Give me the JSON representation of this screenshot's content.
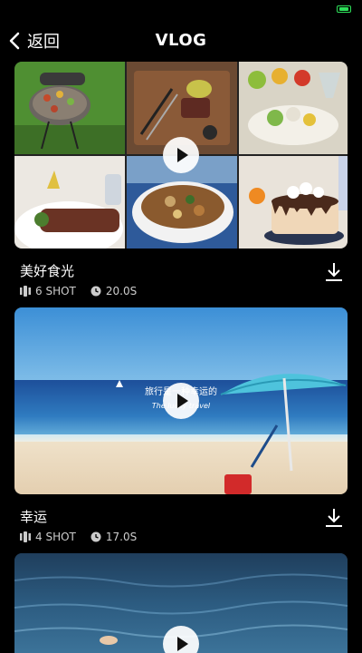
{
  "header": {
    "back_label": "返回",
    "title": "VLOG"
  },
  "cards": [
    {
      "name": "美好食光",
      "shots": "6 SHOT",
      "duration": "20.0S"
    },
    {
      "name": "幸运",
      "shots": "4 SHOT",
      "duration": "17.0S",
      "overlay_line1": "旅行是一种幸运的",
      "overlay_line2": "The lucky travel"
    }
  ]
}
